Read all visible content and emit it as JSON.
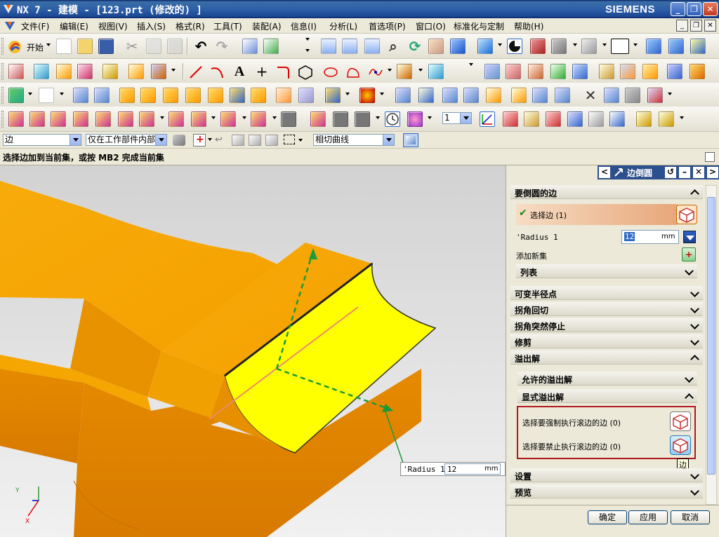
{
  "window": {
    "title": "NX 7 - 建模 - [123.prt (修改的) ]",
    "brand": "SIEMENS",
    "controls": [
      "_",
      "❐",
      "✕"
    ]
  },
  "menu": {
    "items": [
      "文件(F)",
      "编辑(E)",
      "视图(V)",
      "插入(S)",
      "格式(R)",
      "工具(T)",
      "装配(A)",
      "信息(I)",
      "分析(L)",
      "首选项(P)",
      "窗口(O)",
      "标准化与定制",
      "帮助(H)"
    ]
  },
  "toolbar": {
    "start_label": "开始",
    "text_tool_label": "A",
    "plus_tool_label": "+",
    "layer_value": "1"
  },
  "selection_bar": {
    "filter": "边",
    "scope": "仅在工作部件内部",
    "rule": "相切曲线"
  },
  "cue_line": "选择边加到当前集，或按 MB2 完成当前集",
  "viewport": {
    "radius_label": "'Radius 1",
    "radius_value": "12",
    "radius_unit": "mm",
    "colors": {
      "face": "#f7a800",
      "selected_face": "#ffff00",
      "bg": "#e3e3e3"
    }
  },
  "dialog": {
    "title": "边倒圆",
    "sections": {
      "edges_to_blend": "要倒圆的边",
      "select_edge": "选择边 (1)",
      "radius_label": "'Radius 1",
      "radius_value": "12",
      "radius_unit": "mm",
      "add_new_set": "添加新集",
      "list": "列表",
      "variable_radius": "可变半径点",
      "corner_setback": "拐角回切",
      "stop_short": "拐角突然停止",
      "trim": "修剪",
      "overflow": "溢出解",
      "allowed_overflow": "允许的溢出解",
      "explicit_overflow": "显式溢出解",
      "force_roll": "选择要强制执行滚边的边 (0)",
      "prevent_roll": "选择要禁止执行滚边的边 (0)",
      "settings": "设置",
      "preview": "预览"
    },
    "tooltip": "边",
    "buttons": {
      "ok": "确定",
      "apply": "应用",
      "cancel": "取消"
    }
  }
}
